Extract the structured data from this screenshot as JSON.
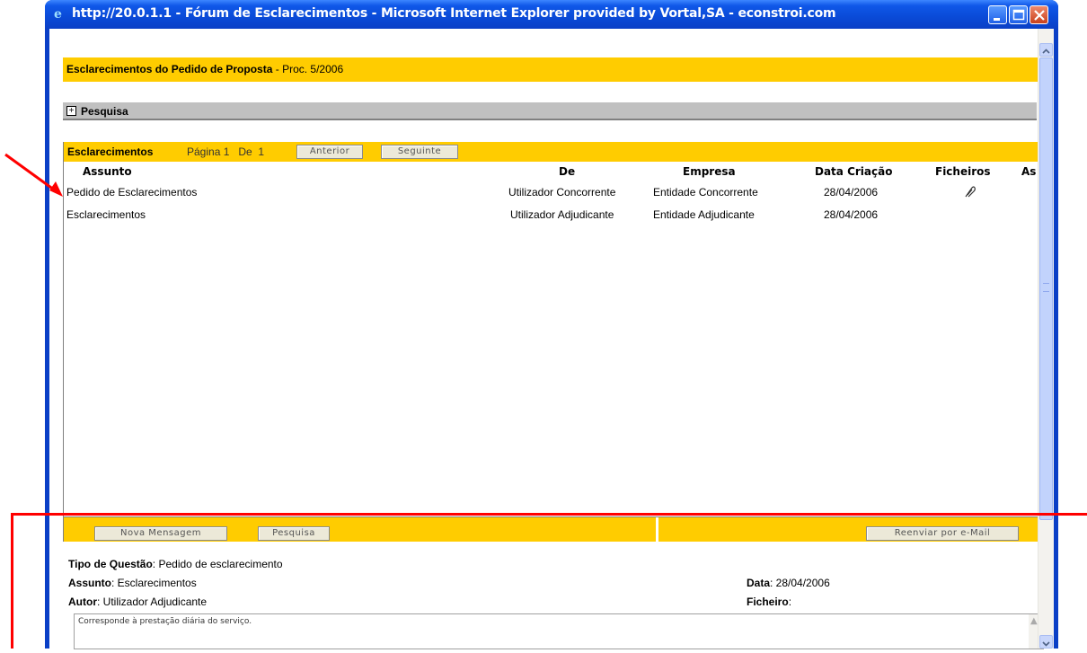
{
  "window": {
    "title": "http://20.0.1.1 - Fórum de Esclarecimentos - Microsoft Internet Explorer provided by Vortal,SA - econstroi.com"
  },
  "header": {
    "title_bold": "Esclarecimentos do Pedido de Proposta",
    "title_rest": " - Proc. 5/2006"
  },
  "search": {
    "toggle": "+",
    "label": "Pesquisa"
  },
  "panel": {
    "title": "Esclarecimentos",
    "pagination": "Página 1   De  1",
    "prev_label": "Anterior",
    "next_label": "Seguinte"
  },
  "columns": {
    "assunto": "Assunto",
    "de": "De",
    "empresa": "Empresa",
    "data": "Data Criação",
    "ficheiros": "Ficheiros",
    "as": "As"
  },
  "rows": [
    {
      "assunto": "Pedido de Esclarecimentos",
      "de": "Utilizador Concorrente",
      "empresa": "Entidade Concorrente",
      "data": "28/04/2006",
      "has_file": true
    },
    {
      "assunto": "Esclarecimentos",
      "de": "Utilizador Adjudicante",
      "empresa": "Entidade Adjudicante",
      "data": "28/04/2006",
      "has_file": false
    }
  ],
  "actions": {
    "nova": "Nova Mensagem",
    "pesquisa": "Pesquisa",
    "reenviar": "Reenviar por e-Mail"
  },
  "details": {
    "tipo_label": "Tipo de Questão",
    "tipo_value": ": Pedido de esclarecimento",
    "assunto_label": "Assunto",
    "assunto_value": ": Esclarecimentos",
    "autor_label": "Autor",
    "autor_value": ": Utilizador Adjudicante",
    "data_label": "Data",
    "data_value": ": 28/04/2006",
    "ficheiro_label": "Ficheiro",
    "ficheiro_value": ":",
    "message": "Corresponde à prestação diária do serviço."
  },
  "colors": {
    "accent_yellow": "#ffcc00",
    "xp_blue": "#0a3fc6",
    "annotation_red": "#ff0000"
  }
}
